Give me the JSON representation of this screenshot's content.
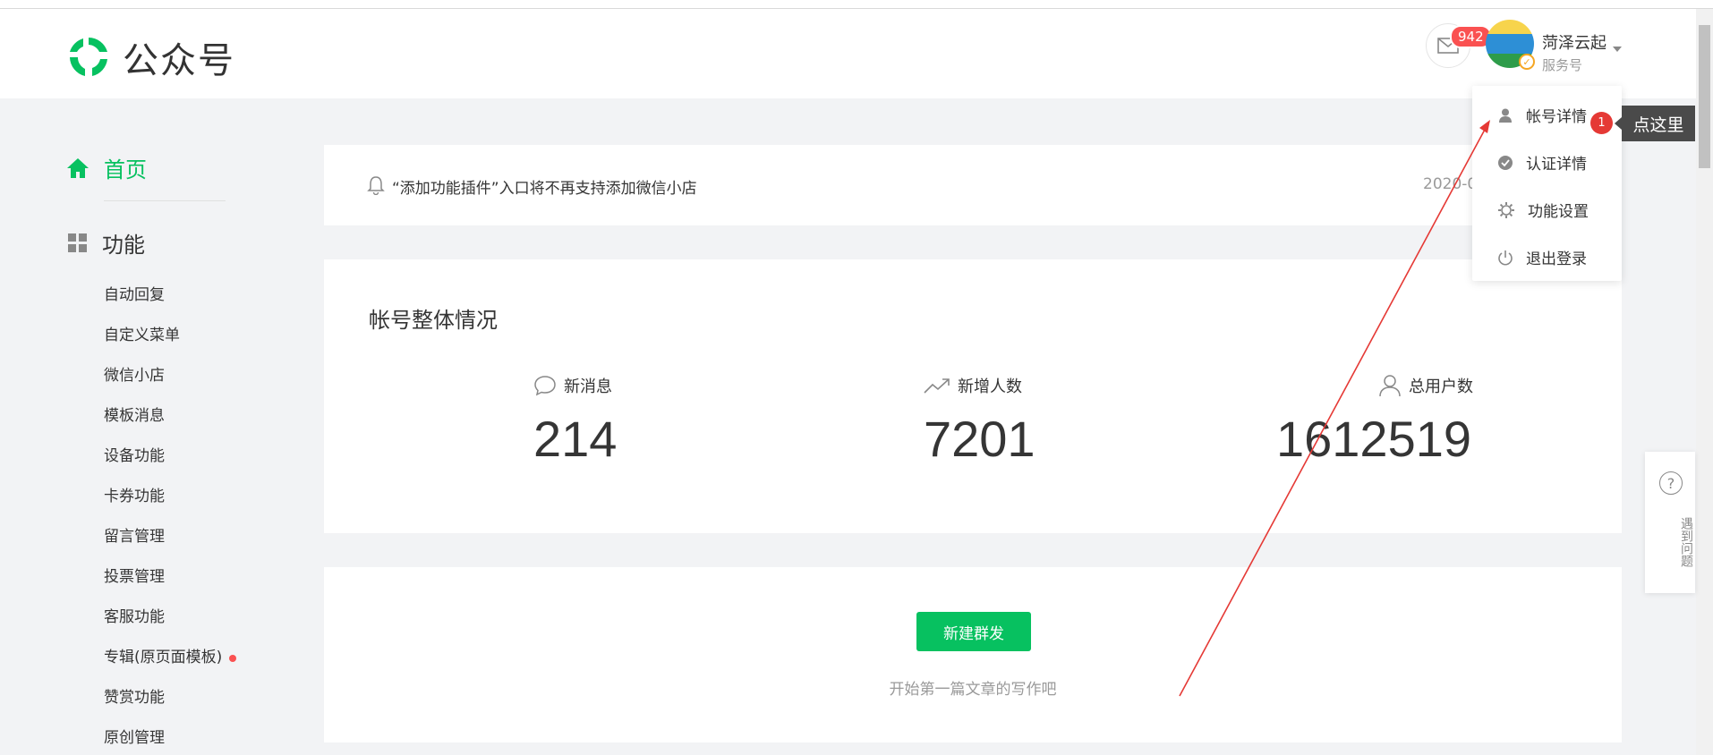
{
  "header": {
    "logo_text": "公众号",
    "message_count": "942",
    "account_name": "菏泽云起",
    "account_type": "服务号"
  },
  "sidebar": {
    "home_label": "首页",
    "function_label": "功能",
    "items": [
      {
        "label": "自动回复"
      },
      {
        "label": "自定义菜单"
      },
      {
        "label": "微信小店"
      },
      {
        "label": "模板消息"
      },
      {
        "label": "设备功能"
      },
      {
        "label": "卡券功能"
      },
      {
        "label": "留言管理"
      },
      {
        "label": "投票管理"
      },
      {
        "label": "客服功能"
      },
      {
        "label": "专辑(原页面模板)",
        "has_dot": true
      },
      {
        "label": "赞赏功能"
      },
      {
        "label": "原创管理"
      }
    ]
  },
  "notice": {
    "text": "“添加功能插件”入口将不再支持添加微信小店",
    "date": "2020-0"
  },
  "overview": {
    "title": "帐号整体情况",
    "stats": [
      {
        "label": "新消息",
        "value": "214",
        "icon": "chat-bubble-icon"
      },
      {
        "label": "新增人数",
        "value": "7201",
        "icon": "trend-up-icon"
      },
      {
        "label": "总用户数",
        "value": "1612519",
        "icon": "user-icon"
      }
    ]
  },
  "compose": {
    "button_label": "新建群发",
    "hint": "开始第一篇文章的写作吧"
  },
  "dropdown": {
    "items": [
      {
        "label": "帐号详情",
        "icon": "user-icon"
      },
      {
        "label": "认证详情",
        "icon": "verified-check-icon"
      },
      {
        "label": "功能设置",
        "icon": "gear-icon"
      },
      {
        "label": "退出登录",
        "icon": "power-icon"
      }
    ]
  },
  "annotation": {
    "tooltip": "点这里",
    "step": "1"
  },
  "help": {
    "text": "遇到问题"
  },
  "colors": {
    "brand": "#07c160",
    "badge": "#fa5151",
    "annotation_red": "#e53935"
  }
}
